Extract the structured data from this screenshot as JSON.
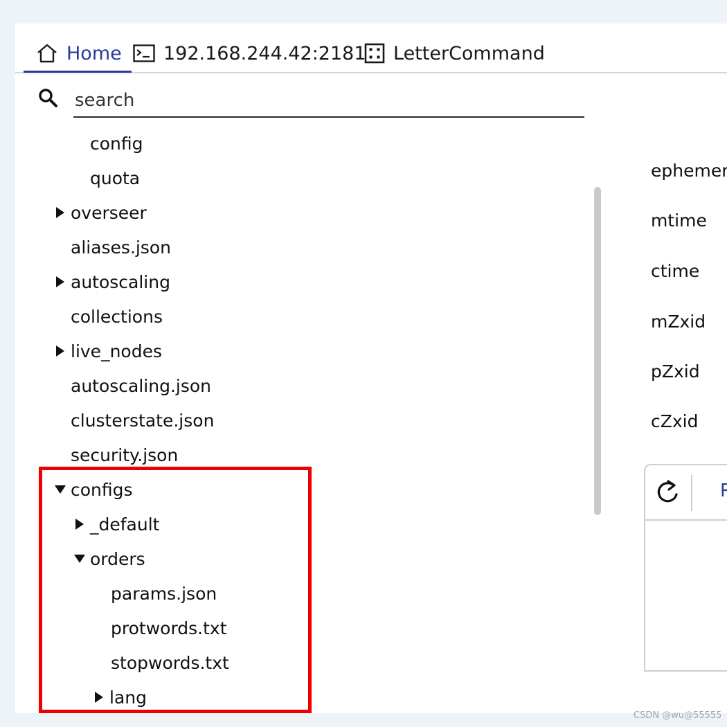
{
  "tabs": [
    {
      "label": "Home",
      "icon": "home-icon",
      "active": true
    },
    {
      "label": "192.168.244.42:2181",
      "icon": "terminal-icon",
      "active": false
    },
    {
      "label": "LetterCommand",
      "icon": "dice-icon",
      "active": false
    }
  ],
  "search": {
    "placeholder": "search",
    "value": ""
  },
  "tree": [
    {
      "label": "config",
      "expandable": false,
      "expanded": false
    },
    {
      "label": "quota",
      "expandable": false,
      "expanded": false
    },
    {
      "label": "overseer",
      "expandable": true,
      "expanded": false
    },
    {
      "label": "aliases.json",
      "expandable": false,
      "expanded": false
    },
    {
      "label": "autoscaling",
      "expandable": true,
      "expanded": false
    },
    {
      "label": "collections",
      "expandable": false,
      "expanded": false
    },
    {
      "label": "live_nodes",
      "expandable": true,
      "expanded": false
    },
    {
      "label": "autoscaling.json",
      "expandable": false,
      "expanded": false
    },
    {
      "label": "clusterstate.json",
      "expandable": false,
      "expanded": false
    },
    {
      "label": "security.json",
      "expandable": false,
      "expanded": false
    },
    {
      "label": "configs",
      "expandable": true,
      "expanded": true
    },
    {
      "label": "_default",
      "expandable": true,
      "expanded": false
    },
    {
      "label": "orders",
      "expandable": true,
      "expanded": true
    },
    {
      "label": "params.json",
      "expandable": false,
      "expanded": false
    },
    {
      "label": "protwords.txt",
      "expandable": false,
      "expanded": false
    },
    {
      "label": "stopwords.txt",
      "expandable": false,
      "expanded": false
    },
    {
      "label": "lang",
      "expandable": true,
      "expanded": false
    }
  ],
  "properties": [
    {
      "label": "ephemera"
    },
    {
      "label": "mtime"
    },
    {
      "label": "ctime"
    },
    {
      "label": "mZxid"
    },
    {
      "label": "pZxid"
    },
    {
      "label": "cZxid"
    }
  ],
  "panel": {
    "tab_label": "R"
  },
  "watermark": "CSDN @wu@55555",
  "colors": {
    "accent": "#2a3a9c",
    "highlight": "#ee0000",
    "background": "#eef3f9"
  }
}
